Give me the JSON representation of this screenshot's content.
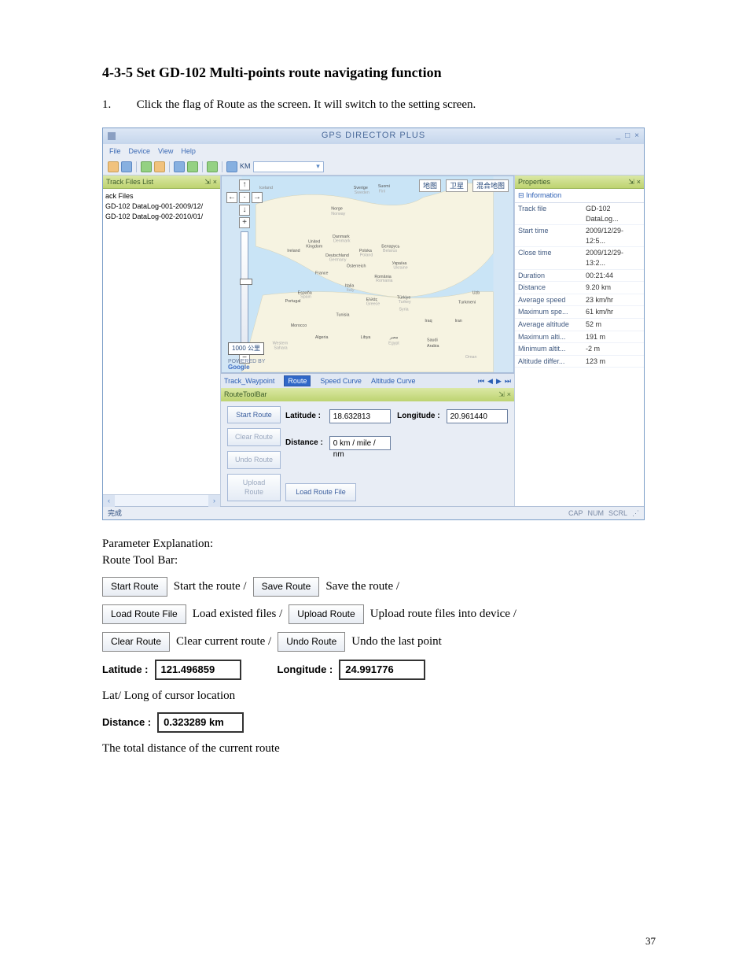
{
  "heading": "4-3-5 Set GD-102 Multi-points route navigating function",
  "instruction": {
    "num": "1.",
    "text": "Click the flag of Route as the screen. It will switch to the setting screen."
  },
  "app": {
    "title": "GPS DIRECTOR PLUS",
    "menu": [
      "File",
      "Device",
      "View",
      "Help"
    ],
    "unit": "KM",
    "trackFiles": {
      "header": "Track Files List",
      "root": "ack Files",
      "items": [
        "GD-102 DataLog-001-2009/12/",
        "GD-102 DataLog-002-2010/01/"
      ]
    },
    "mapCtrls": {
      "map": "地图",
      "sat": "卫星",
      "hybrid": "混合地图"
    },
    "mapLabels": {
      "sverige": "Sverige",
      "sweden": "Sweden",
      "suo": "Suomi",
      "finl": "Finl",
      "iceland": "Iceland",
      "norge": "Norge",
      "norway": "Norway",
      "uk": "United",
      "kingdom": "Kingdom",
      "ireland": "Ireland",
      "danmark": "Danmark",
      "denmark": "Denmark",
      "deutschland": "Deutschland",
      "germany": "Germany",
      "polska": "Polska",
      "poland": "Poland",
      "belarus": "Беларусь",
      "belarus2": "Belarus",
      "ukraine": "Україна",
      "ukraine2": "Ukraine",
      "france": "France",
      "osterreich": "Österreich",
      "romania": "România",
      "romania2": "Romania",
      "italia": "Italia",
      "italy": "Italy",
      "espana": "España",
      "spain": "Spain",
      "portugal": "Portugal",
      "ellada": "Ελλάς",
      "greece": "Greece",
      "turkiye": "Türkiye",
      "turkey": "Turkey",
      "morocco": "Morocco",
      "algeria": "Algeria",
      "tunisia": "Tunisia",
      "libya": "Libya",
      "egypt": "مصر",
      "egypt2": "Egypt",
      "saudi": "Saudi",
      "arabia": "Arabia",
      "iraq": "Iraq",
      "iran": "Iran",
      "syria": "Syria",
      "uzb": "Uzb",
      "turkmeni": "Turkmeni",
      "sahara": "Western",
      "sahara2": "Sahara",
      "oman": "Oman"
    },
    "scalebar": "1000 公里",
    "powered": "POWERED BY",
    "google": "Google",
    "tabs": {
      "track": "Track_Waypoint",
      "route": "Route",
      "speed": "Speed Curve",
      "alt": "Altitude Curve"
    },
    "routeBar": {
      "header": "RouteToolBar",
      "start": "Start Route",
      "clear": "Clear Route",
      "undo": "Undo Route",
      "upload": "Upload Route",
      "load": "Load Route File",
      "latLbl": "Latitude :",
      "latVal": "18.632813",
      "lonLbl": "Longitude :",
      "lonVal": "20.961440",
      "distLbl": "Distance :",
      "distVal": "0 km / mile / nm"
    },
    "props": {
      "header": "Properties",
      "section": "Information",
      "rows": [
        {
          "k": "Track file",
          "v": "GD-102 DataLog..."
        },
        {
          "k": "Start time",
          "v": "2009/12/29-12:5..."
        },
        {
          "k": "Close time",
          "v": "2009/12/29-13:2..."
        },
        {
          "k": "Duration",
          "v": "00:21:44"
        },
        {
          "k": "Distance",
          "v": "9.20 km"
        },
        {
          "k": "Average speed",
          "v": "23 km/hr"
        },
        {
          "k": "Maximum spe...",
          "v": "61 km/hr"
        },
        {
          "k": "Average altitude",
          "v": "52 m"
        },
        {
          "k": "Maximum alti...",
          "v": "191 m"
        },
        {
          "k": "Minimum altit...",
          "v": "-2 m"
        },
        {
          "k": "Altitude differ...",
          "v": "123 m"
        }
      ]
    },
    "status": {
      "left": "完成",
      "caps": "CAP",
      "num": "NUM",
      "scrl": "SCRL"
    }
  },
  "paramHdr": "Parameter Explanation:",
  "rtbHdr": "Route Tool Bar:",
  "line1": {
    "b1": "Start Route",
    "t1": "Start the route /",
    "b2": "Save Route",
    "t2": "Save the route /"
  },
  "line2": {
    "b1": "Load Route File",
    "t1": "Load existed files /",
    "b2": "Upload Route",
    "t2": "Upload route files into device /"
  },
  "line3": {
    "b1": "Clear Route",
    "t1": "Clear current route /",
    "b2": "Undo Route",
    "t2": "Undo the last point"
  },
  "coords": {
    "latLbl": "Latitude :",
    "latVal": "121.496859",
    "lonLbl": "Longitude :",
    "lonVal": "24.991776"
  },
  "coordsDesc": "Lat/ Long of cursor location",
  "dist": {
    "lbl": "Distance :",
    "val": "0.323289 km"
  },
  "distDesc": "The total distance of the current route",
  "pageNum": "37"
}
